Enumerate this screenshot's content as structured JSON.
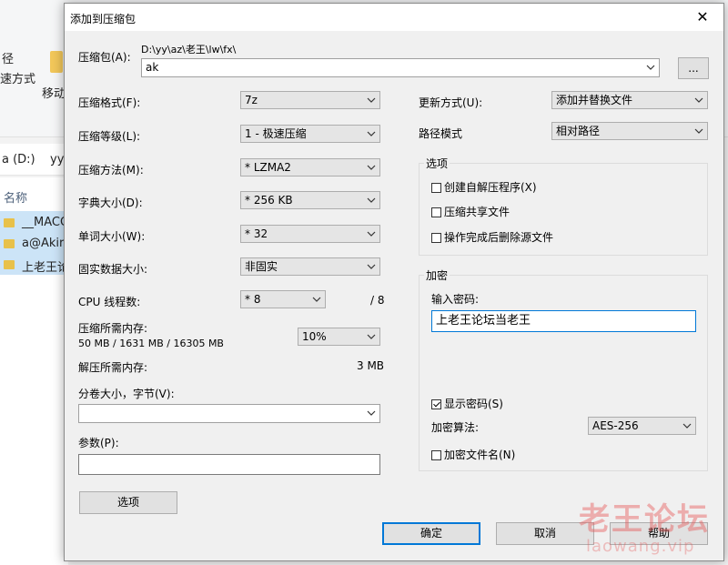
{
  "background_explorer": {
    "ribbon_text_1": "径",
    "ribbon_text_2": "速方式",
    "ribbon_move": "移动",
    "address": "a (D:)",
    "address_2": "yy",
    "column_name": "名称",
    "items": [
      "__MACO",
      "a@Akira",
      "上老王论"
    ]
  },
  "dialog": {
    "title": "添加到压缩包",
    "archive_label": "压缩包(A):",
    "archive_path": "D:\\yy\\az\\老王\\lw\\fx\\",
    "archive_name": "ak",
    "browse_label": "...",
    "format_label": "压缩格式(F):",
    "format_value": "7z",
    "level_label": "压缩等级(L):",
    "level_value": "1 - 极速压缩",
    "method_label": "压缩方法(M):",
    "method_value": "* LZMA2",
    "dict_label": "字典大小(D):",
    "dict_value": "* 256 KB",
    "word_label": "单词大小(W):",
    "word_value": "* 32",
    "solid_label": "固实数据大小:",
    "solid_value": "非固实",
    "threads_label": "CPU 线程数:",
    "threads_value": "* 8",
    "threads_max": "/ 8",
    "mem_comp_label": "压缩所需内存:",
    "mem_comp_value": "50 MB / 1631 MB / 16305 MB",
    "mem_percent": "10%",
    "mem_decomp_label": "解压所需内存:",
    "mem_decomp_value": "3 MB",
    "volume_label": "分卷大小，字节(V):",
    "volume_value": "",
    "params_label": "参数(P):",
    "params_value": "",
    "options_button": "选项",
    "update_label": "更新方式(U):",
    "update_value": "添加并替换文件",
    "path_mode_label": "路径模式",
    "path_mode_value": "相对路径",
    "options_group": "选项",
    "opt_sfx": "创建自解压程序(X)",
    "opt_shared": "压缩共享文件",
    "opt_delete": "操作完成后删除源文件",
    "encryption_group": "加密",
    "password_label": "输入密码:",
    "password_value": "上老王论坛当老王",
    "show_password": "显示密码(S)",
    "enc_method_label": "加密算法:",
    "enc_method_value": "AES-256",
    "encrypt_names": "加密文件名(N)",
    "ok": "确定",
    "cancel": "取消",
    "help": "帮助",
    "close_glyph": "✕"
  },
  "watermark": {
    "cn": "老王论坛",
    "en": "laowang.vip"
  },
  "checkbox_states": {
    "opt_sfx": false,
    "opt_shared": false,
    "opt_delete": false,
    "show_password": true,
    "encrypt_names": false
  },
  "colors": {
    "accent": "#0078d7",
    "watermark": "#e65a5a",
    "folder": "#e8c14a"
  }
}
